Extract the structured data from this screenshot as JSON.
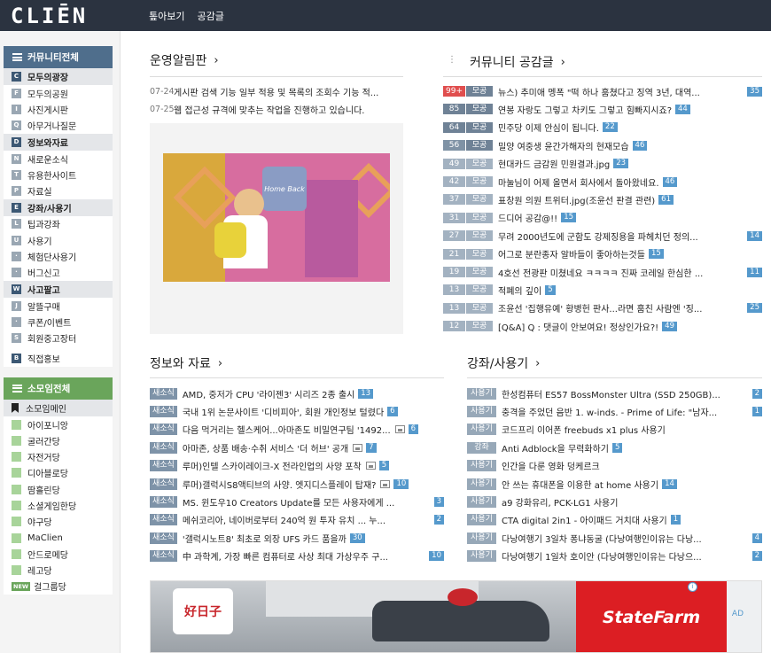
{
  "header": {
    "logo": "CLIĒN",
    "nav": [
      "톺아보기",
      "공감글"
    ]
  },
  "sidebar": {
    "community_title": "커뮤니티전체",
    "groups": [
      {
        "letter": "C",
        "label": "모두의광장",
        "items": [
          {
            "letter": "F",
            "label": "모두의공원"
          },
          {
            "letter": "I",
            "label": "사진게시판"
          },
          {
            "letter": "Q",
            "label": "아무거나질문"
          }
        ]
      },
      {
        "letter": "D",
        "label": "정보와자료",
        "items": [
          {
            "letter": "N",
            "label": "새로운소식"
          },
          {
            "letter": "T",
            "label": "유용한사이트"
          },
          {
            "letter": "P",
            "label": "자료실"
          }
        ]
      },
      {
        "letter": "E",
        "label": "강좌/사용기",
        "items": [
          {
            "letter": "L",
            "label": "팁과강좌"
          },
          {
            "letter": "U",
            "label": "사용기"
          },
          {
            "letter": "·",
            "label": "체험단사용기"
          },
          {
            "letter": "·",
            "label": "버그신고"
          }
        ]
      },
      {
        "letter": "W",
        "label": "사고팔고",
        "items": [
          {
            "letter": "J",
            "label": "알뜰구매"
          },
          {
            "letter": "·",
            "label": "쿠폰/이벤트"
          },
          {
            "letter": "S",
            "label": "회원중고장터"
          }
        ]
      }
    ],
    "promo": {
      "letter": "B",
      "label": "직접홍보"
    },
    "somoim_title": "소모임전체",
    "somoim_main": "소모임메인",
    "somoim_items": [
      "아이포니앙",
      "굴러간당",
      "자전거당",
      "디아블로당",
      "땀흘린당",
      "소셜게임한당",
      "야구당",
      "MaClien",
      "안드로메당",
      "레고당",
      "걸그룹당"
    ],
    "new_badge": "NEW"
  },
  "notice": {
    "title": "운영알림판",
    "items": [
      {
        "date": "07-24",
        "text": "게시판 검색 기능 일부 적용 및 목록의 조회수 기능 적..."
      },
      {
        "date": "07-25",
        "text": "웹 접근성 규격에 맞추는 작업을 진행하고 있습니다."
      }
    ]
  },
  "banner": {
    "sign": "Home Back"
  },
  "best": {
    "title": "커뮤니티 공감글",
    "cat": "모공",
    "items": [
      {
        "count": "99+",
        "text": "뉴스) 추미애 멩폭 \"떡 하나 훔쳤다고 징역 3년, 대역...",
        "comments": "35"
      },
      {
        "count": "85",
        "text": "연봉 자랑도 그렇고 차키도 그렇고 힘빠지시죠?",
        "comments": "44"
      },
      {
        "count": "64",
        "text": "민주당 이제 안심이 됩니다.",
        "comments": "22"
      },
      {
        "count": "56",
        "text": "밀양 여중생 윤간가해자의 현재모습",
        "comments": "46"
      },
      {
        "count": "49",
        "text": "현대카드 금감원 민원결과.jpg",
        "comments": "23"
      },
      {
        "count": "42",
        "text": "마눌님이 어제 올면서 회사에서 돌아왔네요.",
        "comments": "46"
      },
      {
        "count": "37",
        "text": "표창원 의원 트위터.jpg(조윤선 판결 관련)",
        "comments": "61"
      },
      {
        "count": "31",
        "text": "드디어 공감@!!",
        "comments": "15"
      },
      {
        "count": "27",
        "text": "무려 2000년도에 군함도 강제징용을 파헤치던 정의...",
        "comments": "14"
      },
      {
        "count": "21",
        "text": "어그로 분란종자 알바들이 좋아하는것들",
        "comments": "15"
      },
      {
        "count": "19",
        "text": "4호선 전광판 미쳤네요 ㅋㅋㅋㅋ 진짜 코레일 한심한 ...",
        "comments": "11"
      },
      {
        "count": "13",
        "text": "적폐의 깊이",
        "comments": "5"
      },
      {
        "count": "13",
        "text": "조윤선 '집행유예' 황병헌 판사...라면 훔친 사람엔 '징...",
        "comments": "25"
      },
      {
        "count": "12",
        "text": "[Q&A] Q : 댓글이 안보여요! 정상인가요?!",
        "comments": "49"
      }
    ]
  },
  "info": {
    "title": "정보와 자료",
    "tag": "새소식",
    "items": [
      {
        "text": "AMD, 중저가 CPU '라이젠3' 시리즈 2종 출시",
        "comments": "13",
        "img": false
      },
      {
        "text": "국내 1위 논문사이트 '디비피아', 회원 개인정보 털렸다",
        "comments": "6",
        "img": false
      },
      {
        "text": "다음 먹거리는 헬스케어...아마존도 비밀연구팀 '1492...",
        "comments": "6",
        "img": true
      },
      {
        "text": "아마존, 상품 배송·수취 서비스 '더 허브' 공개",
        "comments": "7",
        "img": true
      },
      {
        "text": "루머)인텔 스카이레이크-X 전라인업의 사양 포착",
        "comments": "5",
        "img": true
      },
      {
        "text": "루머)갤럭시S8액티브의 사양. 엣지디스플레이 탑재?",
        "comments": "10",
        "img": true
      },
      {
        "text": "MS. 윈도우10 Creators Update를 모든 사용자에게 ...",
        "comments": "3",
        "img": false
      },
      {
        "text": "메쉬코리아, 네이버로부터 240억 원 투자 유치 ... 누...",
        "comments": "2",
        "img": false
      },
      {
        "text": "'갤럭시노트8' 최초로 외장 UFS 카드 품을까",
        "comments": "30",
        "img": false
      },
      {
        "text": "中 과학계, 가장 빠른 컴퓨터로 사상 최대 가상우주 구...",
        "comments": "10",
        "img": false
      }
    ]
  },
  "lecture": {
    "title": "강좌/사용기",
    "items": [
      {
        "tag": "사용기",
        "text": "한성컴퓨터 ES57 BossMonster Ultra (SSD 250GB)...",
        "comments": "2"
      },
      {
        "tag": "사용기",
        "text": "충격을 주었던 음반 1. w-inds. - Prime of Life: \"남자...",
        "comments": "1"
      },
      {
        "tag": "사용기",
        "text": "코드프리 이어폰 freebuds x1 plus 사용기",
        "comments": ""
      },
      {
        "tag": "강좌",
        "text": "Anti Adblock을 무력화하기",
        "comments": "5"
      },
      {
        "tag": "사용기",
        "text": "인간을 다룬 영화 덩케르크",
        "comments": ""
      },
      {
        "tag": "사용기",
        "text": "안 쓰는 휴대폰을 이용한 at home 사용기",
        "comments": "14"
      },
      {
        "tag": "사용기",
        "text": "a9 강화유리, PCK-LG1 사용기",
        "comments": ""
      },
      {
        "tag": "사용기",
        "text": "CTA digital 2in1 - 아이패드 거치대 사용기",
        "comments": "1"
      },
      {
        "tag": "사용기",
        "text": "다낭여행기 3일차 퐁냐동굴 (다낭여행인이유는 다낭...",
        "comments": "4"
      },
      {
        "tag": "사용기",
        "text": "다낭여행기 1일차 호이안 (다낭여행인이유는 다낭으...",
        "comments": "2"
      }
    ]
  },
  "ad": {
    "speech": "好日子",
    "brand": "StateFarm",
    "label": "AD"
  },
  "colors": {
    "header": "#2b3340",
    "accent": "#5599cc",
    "hot": "#e04e4e"
  }
}
